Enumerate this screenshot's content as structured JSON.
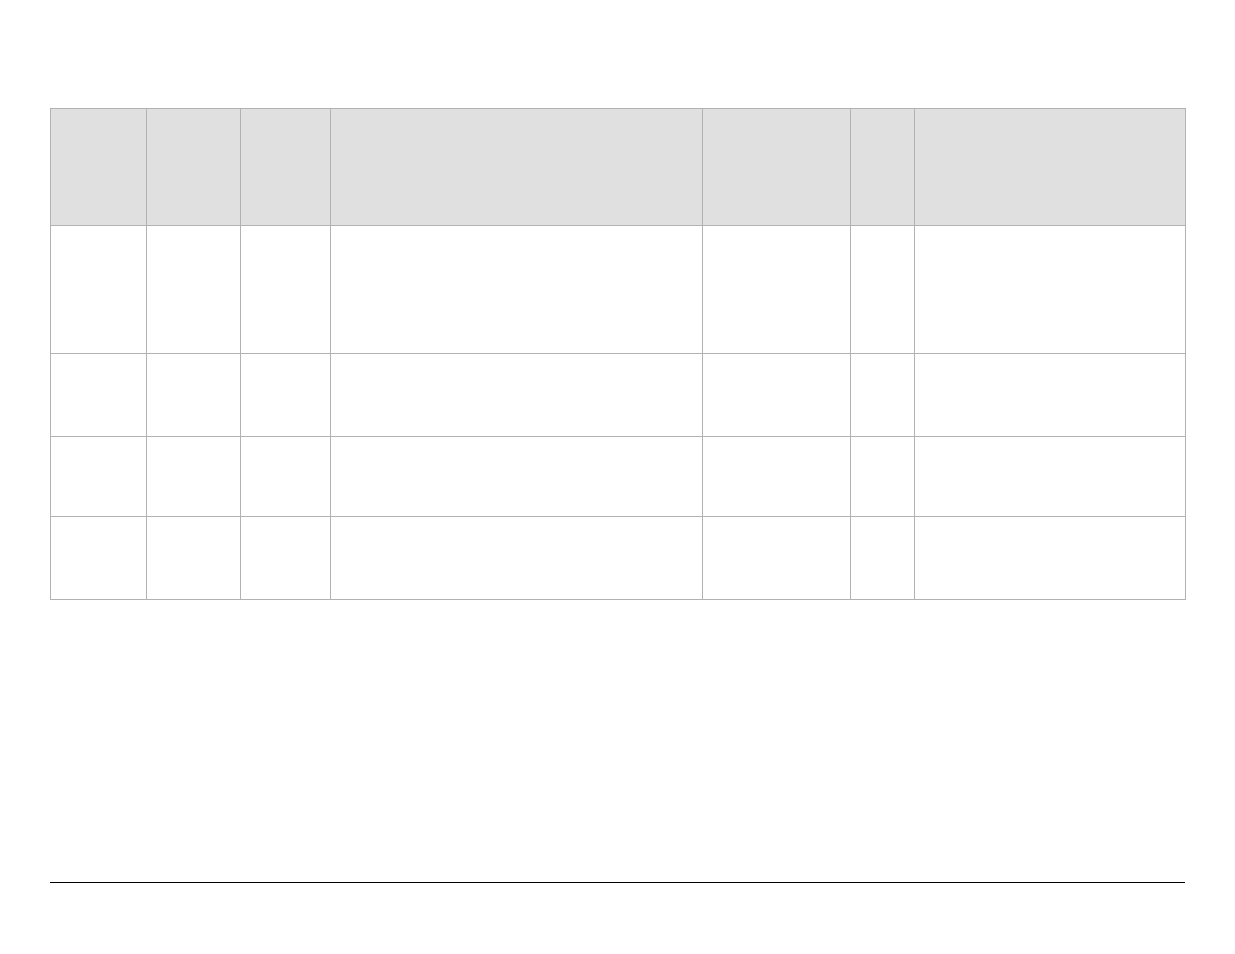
{
  "table": {
    "headers": [
      "",
      "",
      "",
      "",
      "",
      "",
      ""
    ],
    "rows": [
      [
        "",
        "",
        "",
        "",
        "",
        "",
        ""
      ],
      [
        "",
        "",
        "",
        "",
        "",
        "",
        ""
      ],
      [
        "",
        "",
        "",
        "",
        "",
        "",
        ""
      ],
      [
        "",
        "",
        "",
        "",
        "",
        "",
        ""
      ]
    ]
  }
}
